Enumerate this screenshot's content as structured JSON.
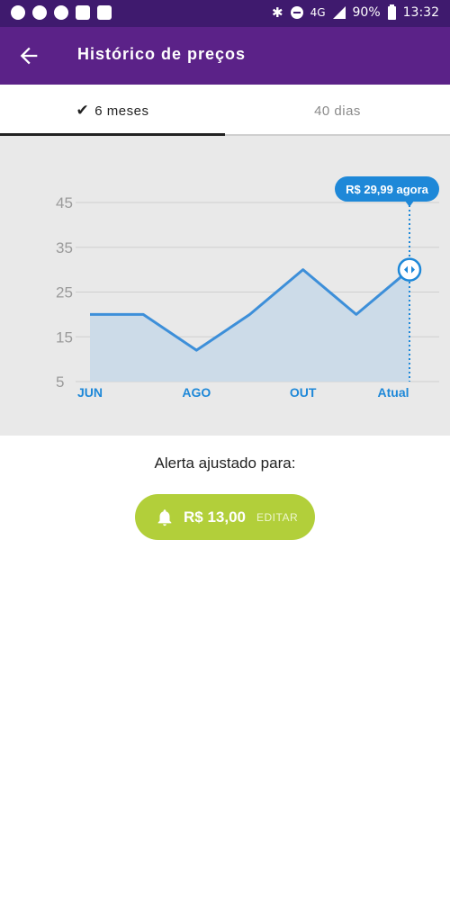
{
  "status_bar": {
    "battery": "90%",
    "time": "13:32",
    "network": "4G"
  },
  "app_bar": {
    "title": "Histórico de preços"
  },
  "tabs": [
    {
      "label": "6 meses",
      "active": true
    },
    {
      "label": "40 dias",
      "active": false
    }
  ],
  "colors": {
    "app_bar": "#5b2288",
    "status_bar": "#3f1a6e",
    "chart_line": "#3d8fd9",
    "chart_fill": "#ccdbe8",
    "marker": "#1e88d8",
    "alert_button": "#b2cf3a"
  },
  "chart_data": {
    "type": "area",
    "x_labels": [
      "JUN",
      "AGO",
      "OUT",
      "Atual"
    ],
    "y_ticks": [
      45,
      35,
      25,
      15,
      5
    ],
    "ylim": [
      5,
      45
    ],
    "series": [
      {
        "values": [
          20,
          20,
          12,
          20,
          30,
          20,
          29.99
        ]
      }
    ],
    "current_tooltip": "R$ 29,99 agora",
    "grid": true
  },
  "alert": {
    "label": "Alerta ajustado para:",
    "price": "R$ 13,00",
    "edit_label": "EDITAR"
  }
}
